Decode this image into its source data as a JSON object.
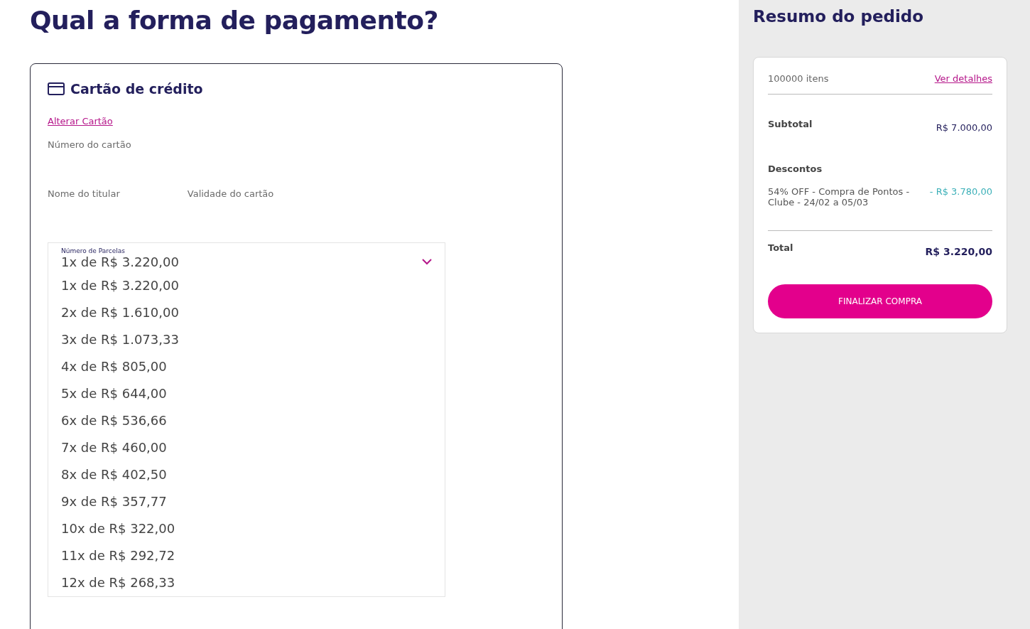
{
  "page_title": "Qual a forma de pagamento?",
  "payment": {
    "title": "Cartão de crédito",
    "change_link": "Alterar Cartão",
    "fields": [
      {
        "label": "Número do cartão"
      },
      {
        "label": "Nome do titular"
      },
      {
        "label": "Validade do cartão"
      }
    ],
    "installments": {
      "label": "Número de Parcelas",
      "value": "1x de R$ 3.220,00",
      "expanded": true,
      "options": [
        "1x de R$ 3.220,00",
        "2x de R$ 1.610,00",
        "3x de R$ 1.073,33",
        "4x de R$ 805,00",
        "5x de R$ 644,00",
        "6x de R$ 536,66",
        "7x de R$ 460,00",
        "8x de R$ 402,50",
        "9x de R$ 357,77",
        "10x de R$ 322,00",
        "11x de R$ 292,72",
        "12x de R$ 268,33"
      ]
    }
  },
  "summary": {
    "title": "Resumo do pedido",
    "items_count": "100000 itens",
    "details_link": "Ver detalhes",
    "subtotal_label": "Subtotal",
    "subtotal_value": "R$ 7.000,00",
    "discounts_label": "Descontos",
    "discounts": [
      {
        "description": "54% OFF - Compra de Pontos - Clube - 24/02 a 05/03",
        "value": "- R$ 3.780,00"
      }
    ],
    "total_label": "Total",
    "total_value": "R$ 3.220,00",
    "button": "FINALIZAR COMPRA"
  }
}
